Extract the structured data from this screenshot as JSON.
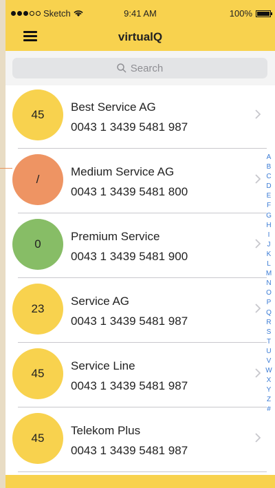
{
  "status_bar": {
    "carrier": "Sketch",
    "time": "9:41 AM",
    "battery": "100%",
    "signal_dots_filled": 3,
    "signal_dots_total": 5
  },
  "nav": {
    "title": "virtualQ",
    "menu_icon": "hamburger-icon"
  },
  "search": {
    "placeholder": "Search",
    "icon": "search-icon"
  },
  "list": [
    {
      "badge": "45",
      "color": "#f8d24e",
      "name": "Best Service AG",
      "phone": "0043 1 3439 5481 987"
    },
    {
      "badge": "/",
      "color": "#ee9463",
      "name": "Medium Service AG",
      "phone": "0043 1 3439 5481 800"
    },
    {
      "badge": "0",
      "color": "#87bd66",
      "name": "Premium Service",
      "phone": "0043 1 3439 5481 900"
    },
    {
      "badge": "23",
      "color": "#f8d24e",
      "name": "Service AG",
      "phone": "0043 1 3439 5481 987"
    },
    {
      "badge": "45",
      "color": "#f8d24e",
      "name": "Service Line",
      "phone": "0043 1 3439 5481 987"
    },
    {
      "badge": "45",
      "color": "#f8d24e",
      "name": "Telekom Plus",
      "phone": "0043 1 3439 5481 987"
    }
  ],
  "index_letters": [
    "A",
    "B",
    "C",
    "D",
    "E",
    "F",
    "G",
    "H",
    "I",
    "J",
    "K",
    "L",
    "M",
    "N",
    "O",
    "P",
    "Q",
    "R",
    "S",
    "T",
    "U",
    "V",
    "W",
    "X",
    "Y",
    "Z",
    "#"
  ],
  "colors": {
    "accent": "#f8d24e",
    "index_text": "#3a7bd5"
  }
}
